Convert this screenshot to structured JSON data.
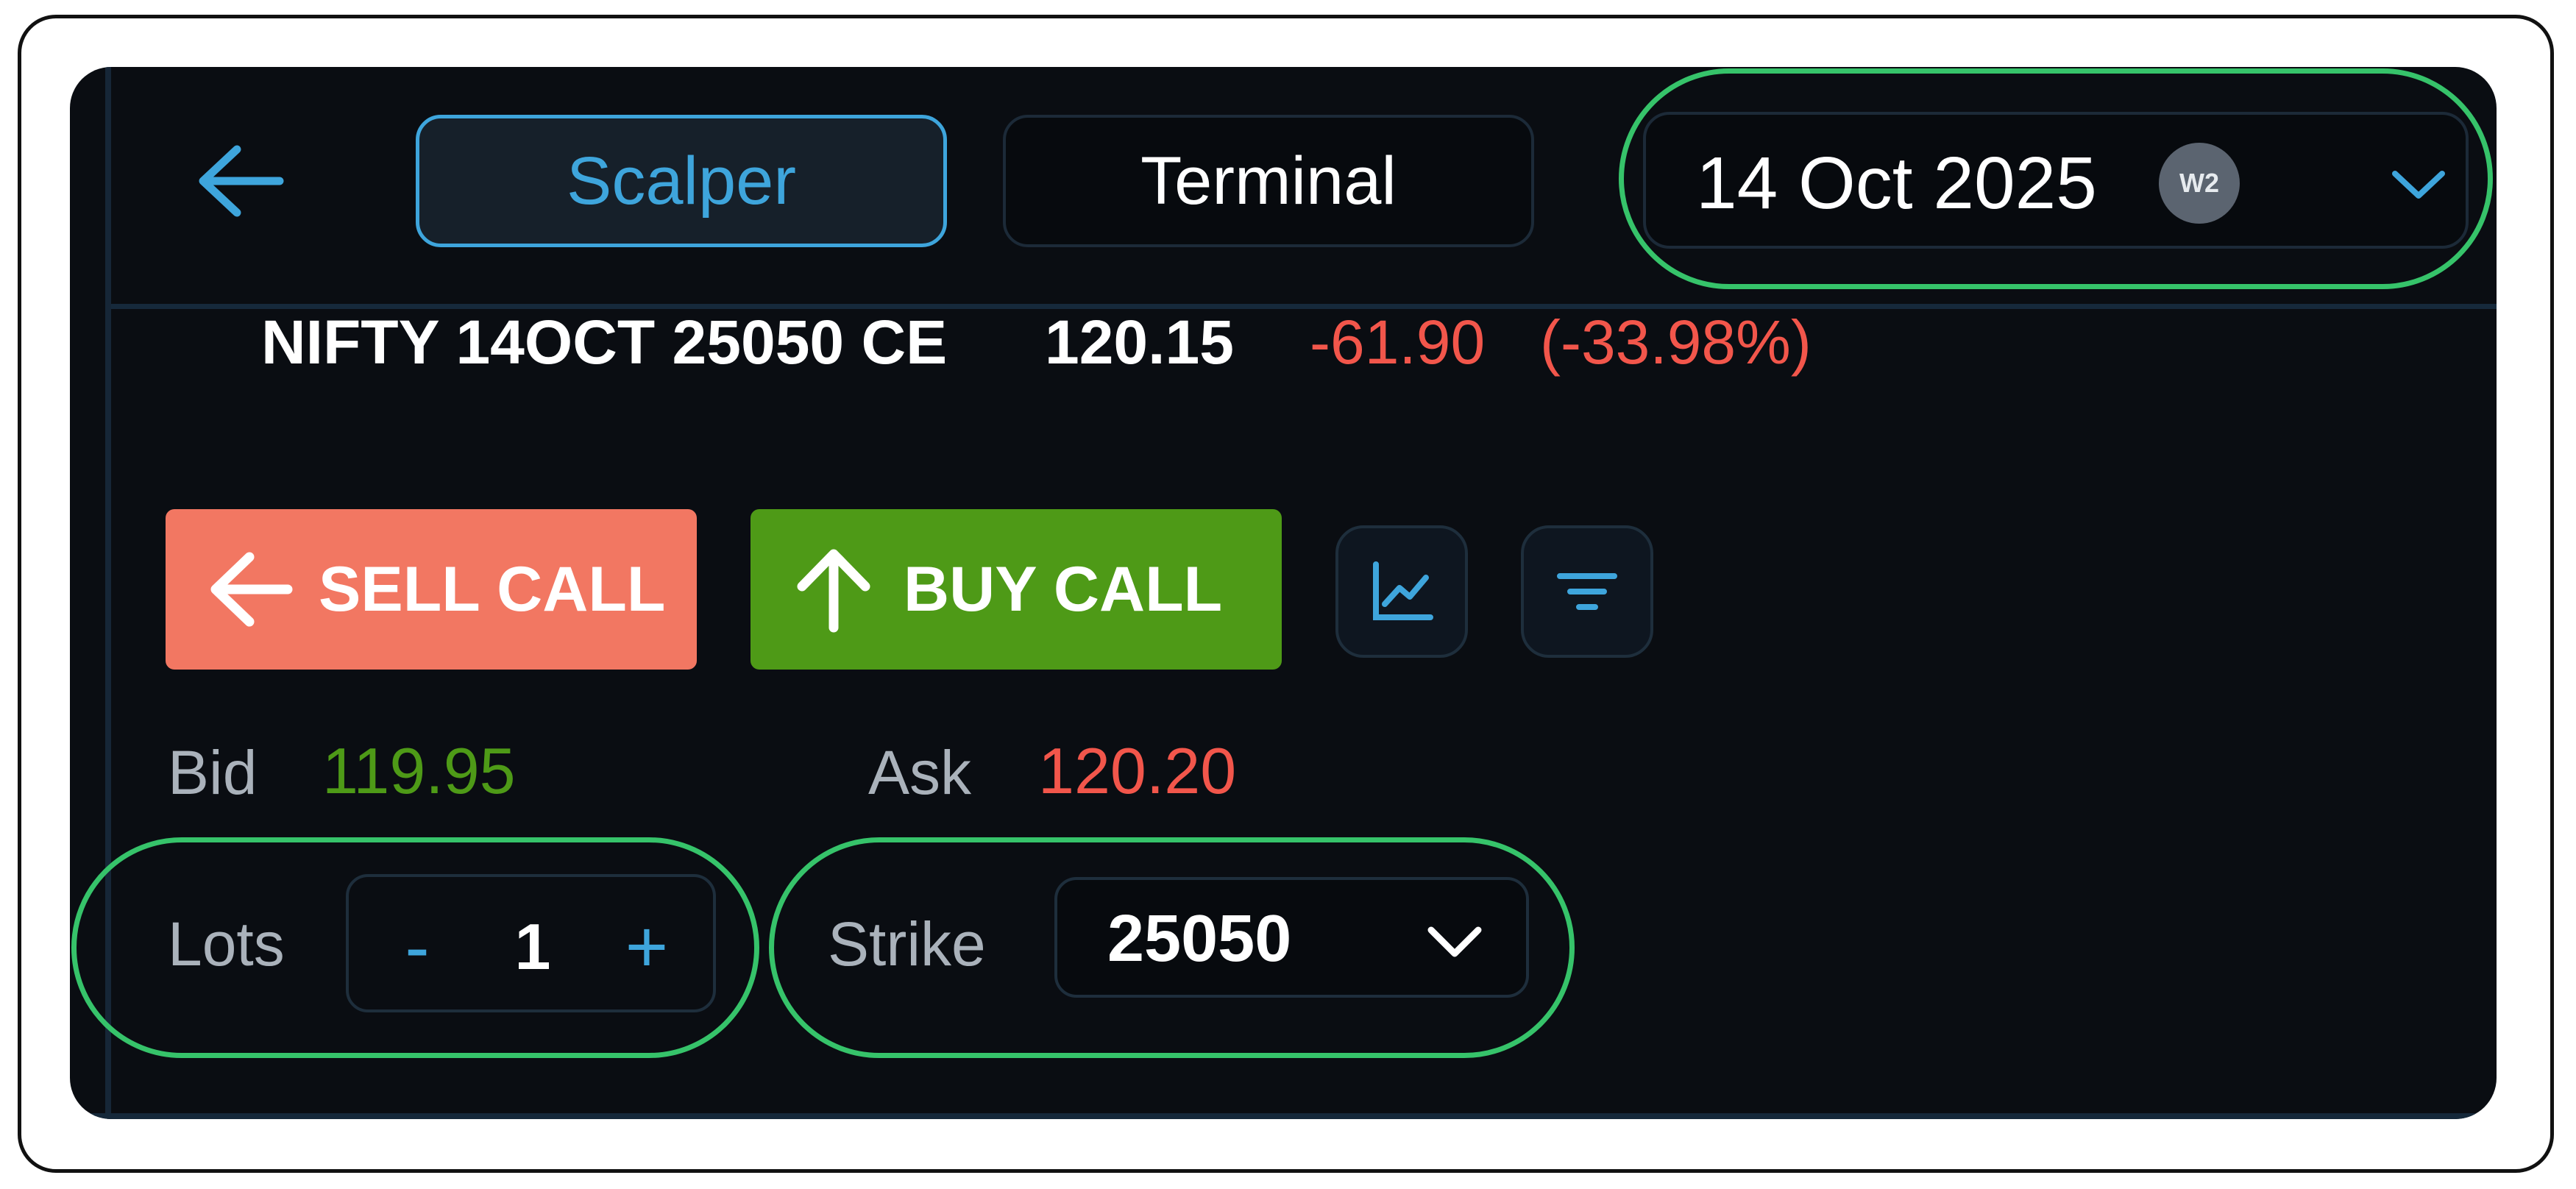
{
  "header": {
    "back_icon": "arrow-left-icon",
    "tabs": [
      {
        "label": "Scalper",
        "active": true
      },
      {
        "label": "Terminal",
        "active": false
      }
    ],
    "expiry": {
      "date": "14 Oct 2025",
      "week_badge": "W2",
      "chevron_icon": "chevron-down-icon"
    }
  },
  "instrument": {
    "symbol": "NIFTY 14OCT 25050 CE",
    "ltp": "120.15",
    "change": "-61.90",
    "change_pct": "(-33.98%)"
  },
  "actions": {
    "sell_label": "SELL CALL",
    "sell_icon": "arrow-left-icon",
    "buy_label": "BUY CALL",
    "buy_icon": "arrow-up-icon",
    "chart_icon": "line-chart-icon",
    "filter_icon": "filter-icon"
  },
  "market": {
    "bid_label": "Bid",
    "bid_value": "119.95",
    "ask_label": "Ask",
    "ask_value": "120.20"
  },
  "order": {
    "lots_label": "Lots",
    "lots_value": "1",
    "minus": "-",
    "plus": "+",
    "strike_label": "Strike",
    "strike_value": "25050"
  },
  "colors": {
    "accent_blue": "#3ea5dc",
    "sell_red": "#f27762",
    "buy_green": "#4e9a17",
    "negative": "#f2564b",
    "highlight_green": "#36c36a",
    "panel_bg": "#0a0d12"
  }
}
